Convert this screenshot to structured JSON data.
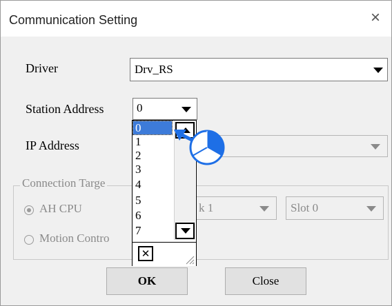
{
  "window": {
    "title": "Communication Setting",
    "close_glyph": "×"
  },
  "driver": {
    "label": "Driver",
    "value": "Drv_RS"
  },
  "station": {
    "label": "Station Address",
    "value": "0"
  },
  "ip": {
    "label": "IP Address",
    "value": ""
  },
  "connection": {
    "legend": "Connection Targe",
    "radio_ah": "AH CPU",
    "radio_motion": "Motion Contro",
    "rack_value": "k 1",
    "slot_value": "Slot 0"
  },
  "dropdown": {
    "items": [
      "0",
      "1",
      "2",
      "3",
      "4",
      "5",
      "6",
      "7"
    ],
    "selected": "0",
    "close_glyph": "✕"
  },
  "buttons": {
    "ok": "OK",
    "close": "Close"
  },
  "colors": {
    "selection": "#3d7bd9",
    "cursor_blue": "#1e6fe6"
  }
}
